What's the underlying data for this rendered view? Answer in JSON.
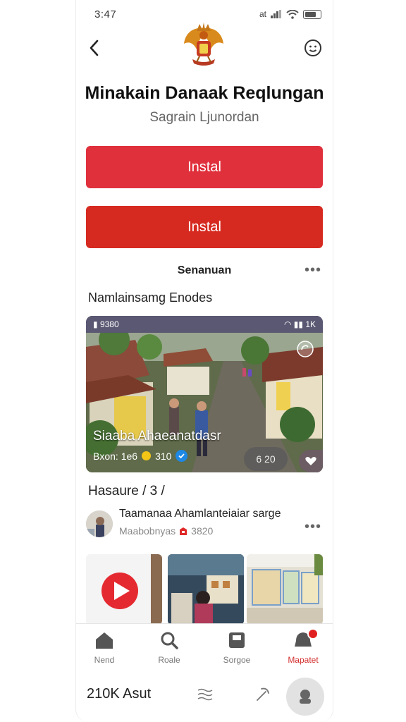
{
  "status_bar": {
    "time": "3:47",
    "signal_text": "at"
  },
  "header": {
    "title": "Minakain Danaak Reqlungan",
    "subtitle": "Sagrain Ljunordan"
  },
  "buttons": {
    "primary_label": "Instal",
    "secondary_label": "Instal"
  },
  "section": {
    "label": "Senanuan",
    "more": "•••",
    "heading": "Namlainsamg Enodes"
  },
  "card": {
    "top_left": "9380",
    "top_right": "1K",
    "caption": "Siaaba Ahaeanatdasr",
    "meta_prefix": "Bxon: 1e6",
    "coin_count": "310",
    "view_count": "6 20"
  },
  "pager": "Hasaure / 3 /",
  "post": {
    "user_name": "Taamanaa Ahamlanteiaiar sarge",
    "user_meta": "Maabobnyas",
    "meta_count": "3820",
    "more": "•••"
  },
  "nav": {
    "items": [
      {
        "label": "Nend",
        "icon": "home-icon"
      },
      {
        "label": "Roale",
        "icon": "search-icon"
      },
      {
        "label": "Sorgoe",
        "icon": "box-icon"
      },
      {
        "label": "Mapatet",
        "icon": "notification-icon",
        "active": true
      }
    ]
  },
  "footer": {
    "text": "210K Asut"
  },
  "colors": {
    "accent": "#e0303c",
    "button_dark": "#d62a20",
    "active_nav": "#d43030"
  }
}
